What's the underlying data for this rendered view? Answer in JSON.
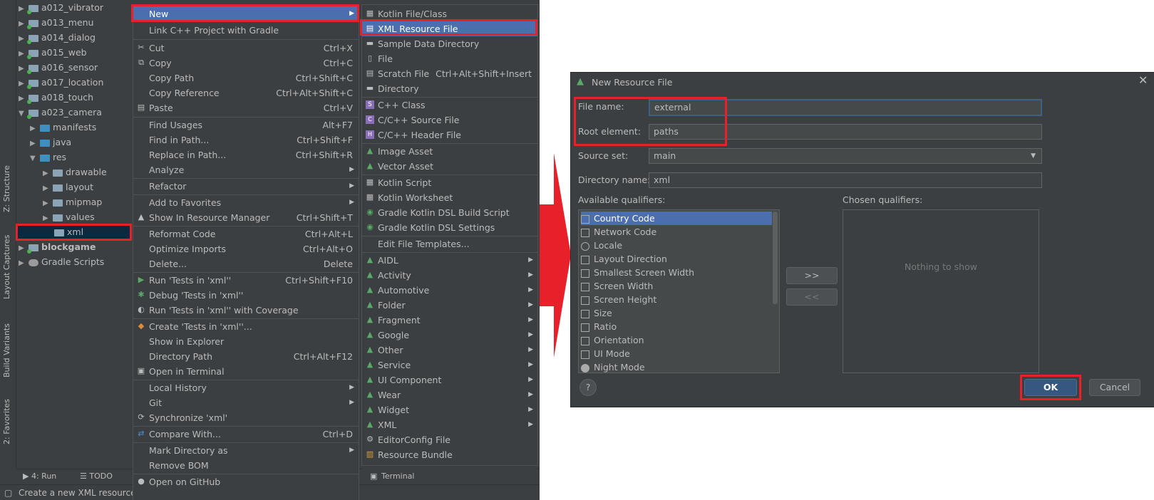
{
  "tree": {
    "items": [
      {
        "label": "a012_vibrator"
      },
      {
        "label": "a013_menu"
      },
      {
        "label": "a014_dialog"
      },
      {
        "label": "a015_web"
      },
      {
        "label": "a016_sensor"
      },
      {
        "label": "a017_location"
      },
      {
        "label": "a018_touch"
      },
      {
        "label": "a023_camera"
      },
      {
        "label": "manifests"
      },
      {
        "label": "java"
      },
      {
        "label": "res"
      },
      {
        "label": "drawable"
      },
      {
        "label": "layout"
      },
      {
        "label": "mipmap"
      },
      {
        "label": "values"
      },
      {
        "label": "xml"
      },
      {
        "label": "blockgame"
      },
      {
        "label": "Gradle Scripts"
      }
    ]
  },
  "side_tabs": [
    "Z: Structure",
    "Layout Captures",
    "Build Variants",
    "2: Favorites"
  ],
  "bottom_tabs": {
    "run": "4: Run",
    "todo": "TODO"
  },
  "status_text": "Create a new XML resource fil",
  "context_menu": {
    "items": [
      {
        "label": "New",
        "shortcut": ""
      },
      {
        "label": "Link C++ Project with Gradle",
        "shortcut": ""
      },
      {
        "label": "Cut",
        "shortcut": "Ctrl+X"
      },
      {
        "label": "Copy",
        "shortcut": "Ctrl+C"
      },
      {
        "label": "Copy Path",
        "shortcut": "Ctrl+Shift+C"
      },
      {
        "label": "Copy Reference",
        "shortcut": "Ctrl+Alt+Shift+C"
      },
      {
        "label": "Paste",
        "shortcut": "Ctrl+V"
      },
      {
        "label": "Find Usages",
        "shortcut": "Alt+F7"
      },
      {
        "label": "Find in Path...",
        "shortcut": "Ctrl+Shift+F"
      },
      {
        "label": "Replace in Path...",
        "shortcut": "Ctrl+Shift+R"
      },
      {
        "label": "Analyze",
        "shortcut": ""
      },
      {
        "label": "Refactor",
        "shortcut": ""
      },
      {
        "label": "Add to Favorites",
        "shortcut": ""
      },
      {
        "label": "Show In Resource Manager",
        "shortcut": "Ctrl+Shift+T"
      },
      {
        "label": "Reformat Code",
        "shortcut": "Ctrl+Alt+L"
      },
      {
        "label": "Optimize Imports",
        "shortcut": "Ctrl+Alt+O"
      },
      {
        "label": "Delete...",
        "shortcut": "Delete"
      },
      {
        "label": "Run 'Tests in 'xml''",
        "shortcut": "Ctrl+Shift+F10"
      },
      {
        "label": "Debug 'Tests in 'xml''",
        "shortcut": ""
      },
      {
        "label": "Run 'Tests in 'xml'' with Coverage",
        "shortcut": ""
      },
      {
        "label": "Create 'Tests in 'xml''...",
        "shortcut": ""
      },
      {
        "label": "Show in Explorer",
        "shortcut": ""
      },
      {
        "label": "Directory Path",
        "shortcut": "Ctrl+Alt+F12"
      },
      {
        "label": "Open in Terminal",
        "shortcut": ""
      },
      {
        "label": "Local History",
        "shortcut": ""
      },
      {
        "label": "Git",
        "shortcut": ""
      },
      {
        "label": "Synchronize 'xml'",
        "shortcut": ""
      },
      {
        "label": "Compare With...",
        "shortcut": "Ctrl+D"
      },
      {
        "label": "Mark Directory as",
        "shortcut": ""
      },
      {
        "label": "Remove BOM",
        "shortcut": ""
      },
      {
        "label": "Open on GitHub",
        "shortcut": ""
      }
    ]
  },
  "new_submenu": {
    "items": [
      {
        "label": "Kotlin File/Class"
      },
      {
        "label": "XML Resource File"
      },
      {
        "label": "Sample Data Directory"
      },
      {
        "label": "File"
      },
      {
        "label": "Scratch File",
        "shortcut": "Ctrl+Alt+Shift+Insert"
      },
      {
        "label": "Directory"
      },
      {
        "label": "C++ Class"
      },
      {
        "label": "C/C++ Source File"
      },
      {
        "label": "C/C++ Header File"
      },
      {
        "label": "Image Asset"
      },
      {
        "label": "Vector Asset"
      },
      {
        "label": "Kotlin Script"
      },
      {
        "label": "Kotlin Worksheet"
      },
      {
        "label": "Gradle Kotlin DSL Build Script"
      },
      {
        "label": "Gradle Kotlin DSL Settings"
      },
      {
        "label": "Edit File Templates..."
      },
      {
        "label": "AIDL"
      },
      {
        "label": "Activity"
      },
      {
        "label": "Automotive"
      },
      {
        "label": "Folder"
      },
      {
        "label": "Fragment"
      },
      {
        "label": "Google"
      },
      {
        "label": "Other"
      },
      {
        "label": "Service"
      },
      {
        "label": "UI Component"
      },
      {
        "label": "Wear"
      },
      {
        "label": "Widget"
      },
      {
        "label": "XML"
      },
      {
        "label": "EditorConfig File"
      },
      {
        "label": "Resource Bundle"
      }
    ],
    "terminal_label": "Terminal"
  },
  "dialog": {
    "title": "New Resource File",
    "file_name_label": "File name:",
    "file_name_value": "external",
    "root_element_label": "Root element:",
    "root_element_value": "paths",
    "source_set_label": "Source set:",
    "source_set_value": "main",
    "directory_name_label": "Directory name:",
    "directory_name_value": "xml",
    "available_label": "Available qualifiers:",
    "chosen_label": "Chosen qualifiers:",
    "qualifiers": [
      "Country Code",
      "Network Code",
      "Locale",
      "Layout Direction",
      "Smallest Screen Width",
      "Screen Width",
      "Screen Height",
      "Size",
      "Ratio",
      "Orientation",
      "UI Mode",
      "Night Mode"
    ],
    "add_button": ">>",
    "remove_button": "<<",
    "empty_text": "Nothing to show",
    "help": "?",
    "ok": "OK",
    "cancel": "Cancel"
  },
  "colors": {
    "accent": "#4b6eaf",
    "highlight_box": "#e8202a",
    "arrow": "#e8202a",
    "bg": "#3c3f41"
  }
}
